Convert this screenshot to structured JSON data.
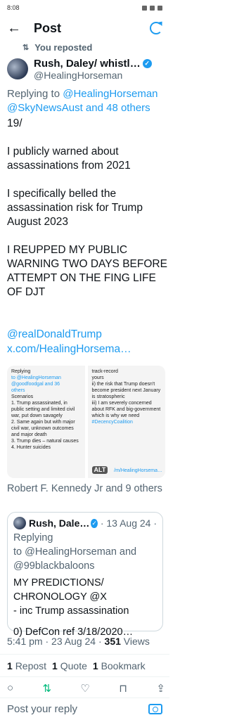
{
  "status": {
    "time": "8:08"
  },
  "header": {
    "title": "Post",
    "back_icon": "←"
  },
  "repost_note": {
    "icon": "⇅",
    "text": "You reposted"
  },
  "author": {
    "name": "Rush, Daley/ whistl…",
    "handle": "@HealingHorseman",
    "verified": "✓"
  },
  "reply_to": {
    "prefix": "Replying to ",
    "users": "@HealingHorseman @SkyNewsAust and 48 others"
  },
  "tweet": {
    "paragraphs": [
      "19/",
      "I publicly warned about assassinations from 2021",
      "I specifically belled the assassination risk for Trump August 2023",
      "I REUPPED MY PUBLIC WARNING TWO DAYS BEFORE ATTEMPT ON THE FING LIFE OF DJT"
    ],
    "mention": "@realDonaldTrump",
    "link": "x.com/HealingHorsema…"
  },
  "media": {
    "left": {
      "line1": "Replying",
      "line2": "to @HealingHorseman",
      "line3": "@goodfoodgal and 36",
      "line4": "others",
      "line5": "Scenarios",
      "line6": "1. Trump assassinated, in public setting and limited civil war, put down savagely",
      "line7": "2. Same again but with major civil war, unknown outcomes and major death",
      "line8": "3. Trump dies – natural causes",
      "line9": "4. Hunter suicides"
    },
    "right": {
      "line1": "track-record",
      "line2": "yours",
      "line3": "ii) the risk that Trump doesn't become president next January is stratospheric",
      "line4": "iii) I am severely concerned about RFK and big-government which is why we need",
      "line5": "#DecencyCoalition"
    },
    "alt_badge": "ALT",
    "image_url": "/m/HealingHorsema…"
  },
  "liked_by": "Robert F. Kennedy Jr and 9 others",
  "quote": {
    "name": "Rush, Dale…",
    "verified": "✓",
    "date": "· 13 Aug 24 ·",
    "reply_prefix": "Replying",
    "reply_to": "to @HealingHorseman and @99blackbaloons",
    "line1": "MY PREDICTIONS/",
    "line2": "CHRONOLOGY @X",
    "line3": "- inc Trump assassination",
    "line4": "0) DefCon ref 3/18/2020…"
  },
  "meta": {
    "time_date": "5:41 pm · 23 Aug 24 · ",
    "views_count": "351",
    "views_label": " Views"
  },
  "stats": {
    "reposts_count": "1",
    "reposts_label": "Repost",
    "quotes_count": "1",
    "quotes_label": "Quote",
    "bookmarks_count": "1",
    "bookmarks_label": "Bookmark"
  },
  "actions": {
    "reply": "○",
    "repost": "⇅",
    "like": "♡",
    "bookmark": "⊓",
    "share": "⇪"
  },
  "reply_bar": {
    "placeholder": "Post your reply"
  }
}
